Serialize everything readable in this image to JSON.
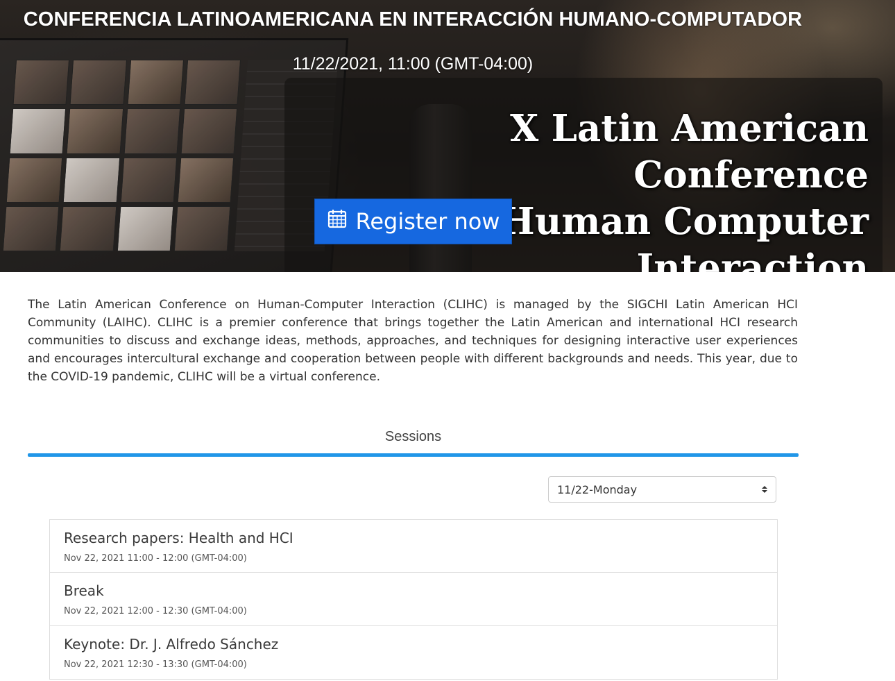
{
  "hero": {
    "title": "CONFERENCIA LATINOAMERICANA EN INTERACCIÓN HUMANO-COMPUTADOR",
    "date": "11/22/2021, 11:00 (GMT-04:00)",
    "banner_lines": [
      "X Latin American Conference",
      "on Human Computer",
      "Interaction"
    ],
    "register_label": "Register now",
    "register_icon": "calendar-icon"
  },
  "description": "The Latin American Conference on Human-Computer Interaction (CLIHC) is managed by the SIGCHI Latin American HCI Community (LAIHC). CLIHC is a premier conference that brings together the Latin American and international HCI research communities to discuss and exchange ideas, methods, approaches, and techniques for designing interactive user experiences and encourages intercultural exchange and cooperation between people with different backgrounds and needs. This year, due to the COVID-19 pandemic, CLIHC will be a virtual conference.",
  "tabs": {
    "sessions_label": "Sessions",
    "active_color": "#2196e8"
  },
  "day_select": {
    "selected": "11/22-Monday"
  },
  "sessions": [
    {
      "title": "Research papers: Health and HCI",
      "time": "Nov 22, 2021 11:00 - 12:00 (GMT-04:00)"
    },
    {
      "title": "Break",
      "time": "Nov 22, 2021 12:00 - 12:30 (GMT-04:00)"
    },
    {
      "title": "Keynote: Dr. J. Alfredo Sánchez",
      "time": "Nov 22, 2021 12:30 - 13:30 (GMT-04:00)"
    }
  ],
  "colors": {
    "register_button": "#1668e0",
    "text": "#333333"
  }
}
